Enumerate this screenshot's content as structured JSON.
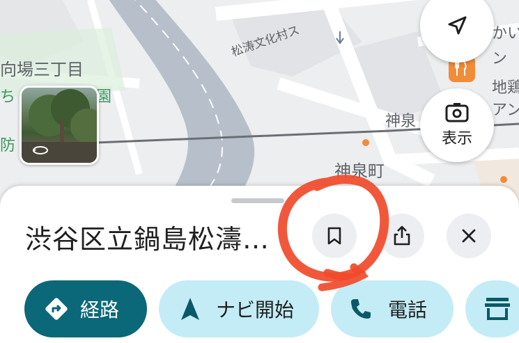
{
  "map": {
    "labels": {
      "area_line1": "向場三丁目",
      "area_line2": "ち",
      "area_line3": "園",
      "area_line4": "防",
      "street": "松涛文化村ス",
      "right_top": "かい",
      "right_2": "ン",
      "right_3": "地鶏",
      "right_4": "アン",
      "station_partial": "神泉",
      "town": "神泉町"
    },
    "street_view_icon": "street-view-rotate-icon",
    "restaurant_icon": "fork-knife-icon"
  },
  "controls": {
    "navigation_icon": "navigation-arrow-icon",
    "show_label": "表示",
    "lens_icon": "lens-camera-icon"
  },
  "sheet": {
    "title": "渋谷区立鍋島松濤…",
    "buttons": {
      "save_icon": "bookmark-icon",
      "share_icon": "share-icon",
      "close_icon": "close-icon"
    },
    "chips": {
      "directions": "経路",
      "navigate": "ナビ開始",
      "call": "電話"
    }
  },
  "colors": {
    "primary": "#0b6878",
    "chip": "#c3ecf6",
    "annotation": "#f04a2a",
    "poi": "#f28c38"
  }
}
